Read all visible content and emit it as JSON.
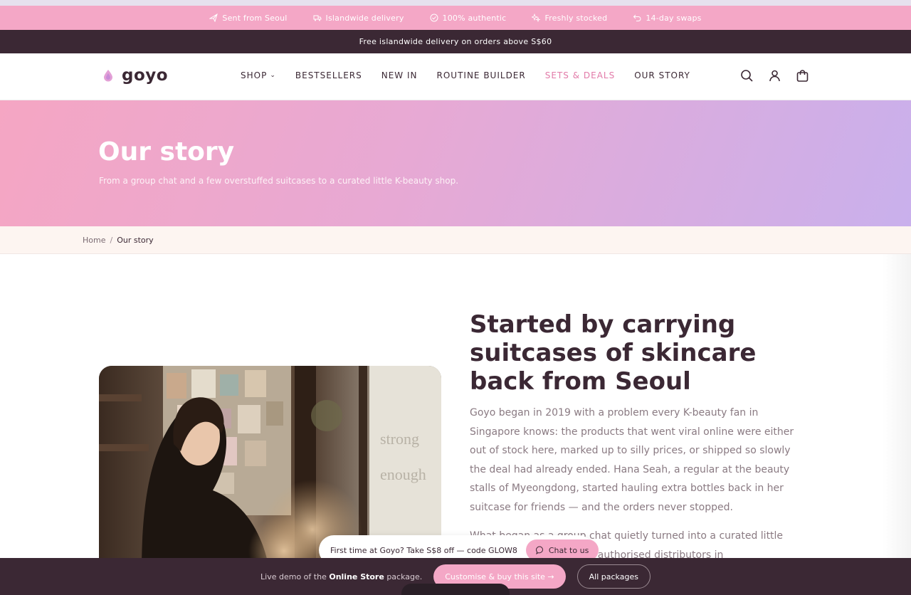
{
  "perks": [
    {
      "label": "Sent from Seoul",
      "icon": "plane-icon"
    },
    {
      "label": "Islandwide delivery",
      "icon": "truck-icon"
    },
    {
      "label": "100% authentic",
      "icon": "check-circle-icon"
    },
    {
      "label": "Freshly stocked",
      "icon": "sparkle-icon"
    },
    {
      "label": "14-day swaps",
      "icon": "return-icon"
    }
  ],
  "announcement": "Free islandwide delivery on orders above S$60",
  "brand": {
    "name": "goyo",
    "accent": "#f4a7c6",
    "dark": "#3b2834"
  },
  "nav": {
    "shop": "SHOP",
    "bestsellers": "BESTSELLERS",
    "new_in": "NEW IN",
    "routine_builder": "ROUTINE BUILDER",
    "sets_deals": "SETS & DEALS",
    "our_story": "OUR STORY"
  },
  "header_icons": [
    "search-icon",
    "user-icon",
    "cart-icon"
  ],
  "hero": {
    "title": "Our story",
    "subtitle": "From a group chat and a few overstuffed suitcases to a curated little K-beauty shop."
  },
  "breadcrumb": {
    "home": "Home",
    "separator": "/",
    "current": "Our story"
  },
  "story": {
    "title": "Started by carrying suitcases of skincare back from Seoul",
    "paragraph1": "Goyo began in 2019 with a problem every K-beauty fan in Singapore knows: the products that went viral online were either out of stock here, marked up to silly prices, or shipped so slowly the deal had already ended. Hana Seah, a regular at the beauty stalls of Myeongdong, started hauling extra bottles back in her suitcase for friends — and the orders never stopped.",
    "paragraph2": "What began as a group chat quietly turned into a curated little shop. …y with labels and authorised distributors in"
  },
  "promo": {
    "text": "First time at Goyo? Take S$8 off — code GLOW8",
    "chat_label": "Chat to us"
  },
  "demo_bar": {
    "prefix": "Live demo of the",
    "package": "Online Store",
    "suffix": "package.",
    "customise_label": "Customise & buy this site →",
    "packages_label": "All packages"
  }
}
